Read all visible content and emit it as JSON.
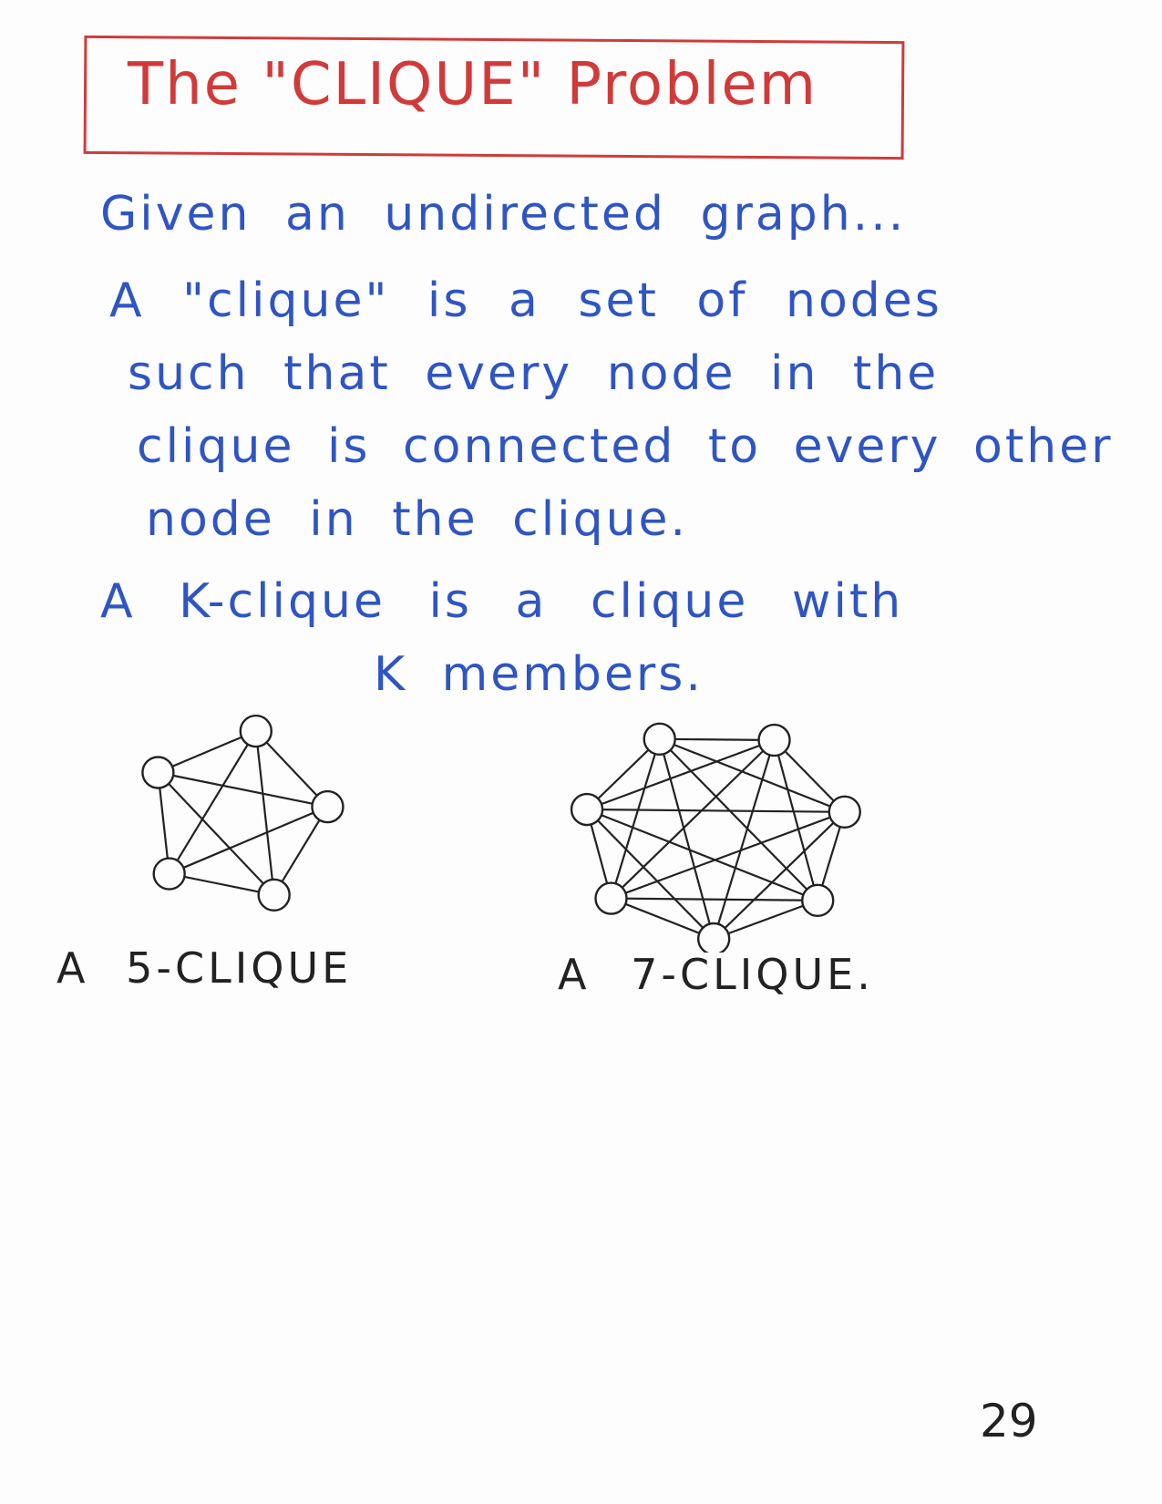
{
  "title": "The \"CLIQUE\" Problem",
  "lines": [
    "Given an undirected graph...",
    "A \"clique\" is a set of nodes",
    "such that every node in the",
    "clique is connected to every other",
    "node in the clique.",
    "A K-clique is a clique with",
    "K members."
  ],
  "captions": {
    "five": "A 5-CLIQUE",
    "seven": "A 7-CLIQUE."
  },
  "page_number": "29",
  "colors": {
    "title": "#d23a3a",
    "body": "#2f55c4",
    "ink": "#222222"
  }
}
